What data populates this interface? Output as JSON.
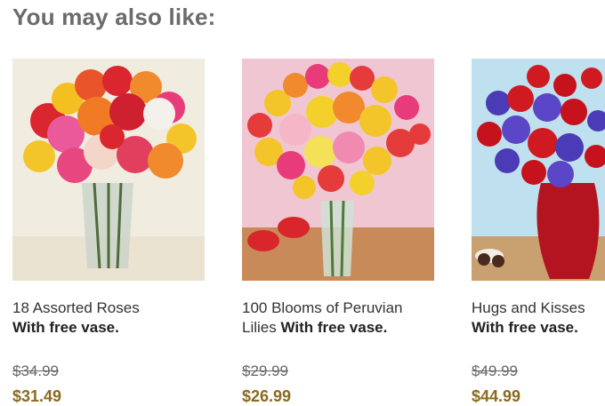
{
  "section_title": "You may also like:",
  "products": [
    {
      "name": "18 Assorted Roses",
      "name_line2": "",
      "vase_text": "With free vase.",
      "old_price": "$34.99",
      "new_price": "$31.49"
    },
    {
      "name": "100 Blooms of Peruvian",
      "name_line2": "Lilies",
      "vase_text": "With free vase.",
      "old_price": "$29.99",
      "new_price": "$26.99"
    },
    {
      "name": "Hugs and Kisses",
      "name_line2": "",
      "vase_text": "With free vase.",
      "old_price": "$49.99",
      "new_price": "$44.99"
    }
  ],
  "colors": {
    "heading": "#6b6b6b",
    "sale_price": "#8a6a1e"
  }
}
